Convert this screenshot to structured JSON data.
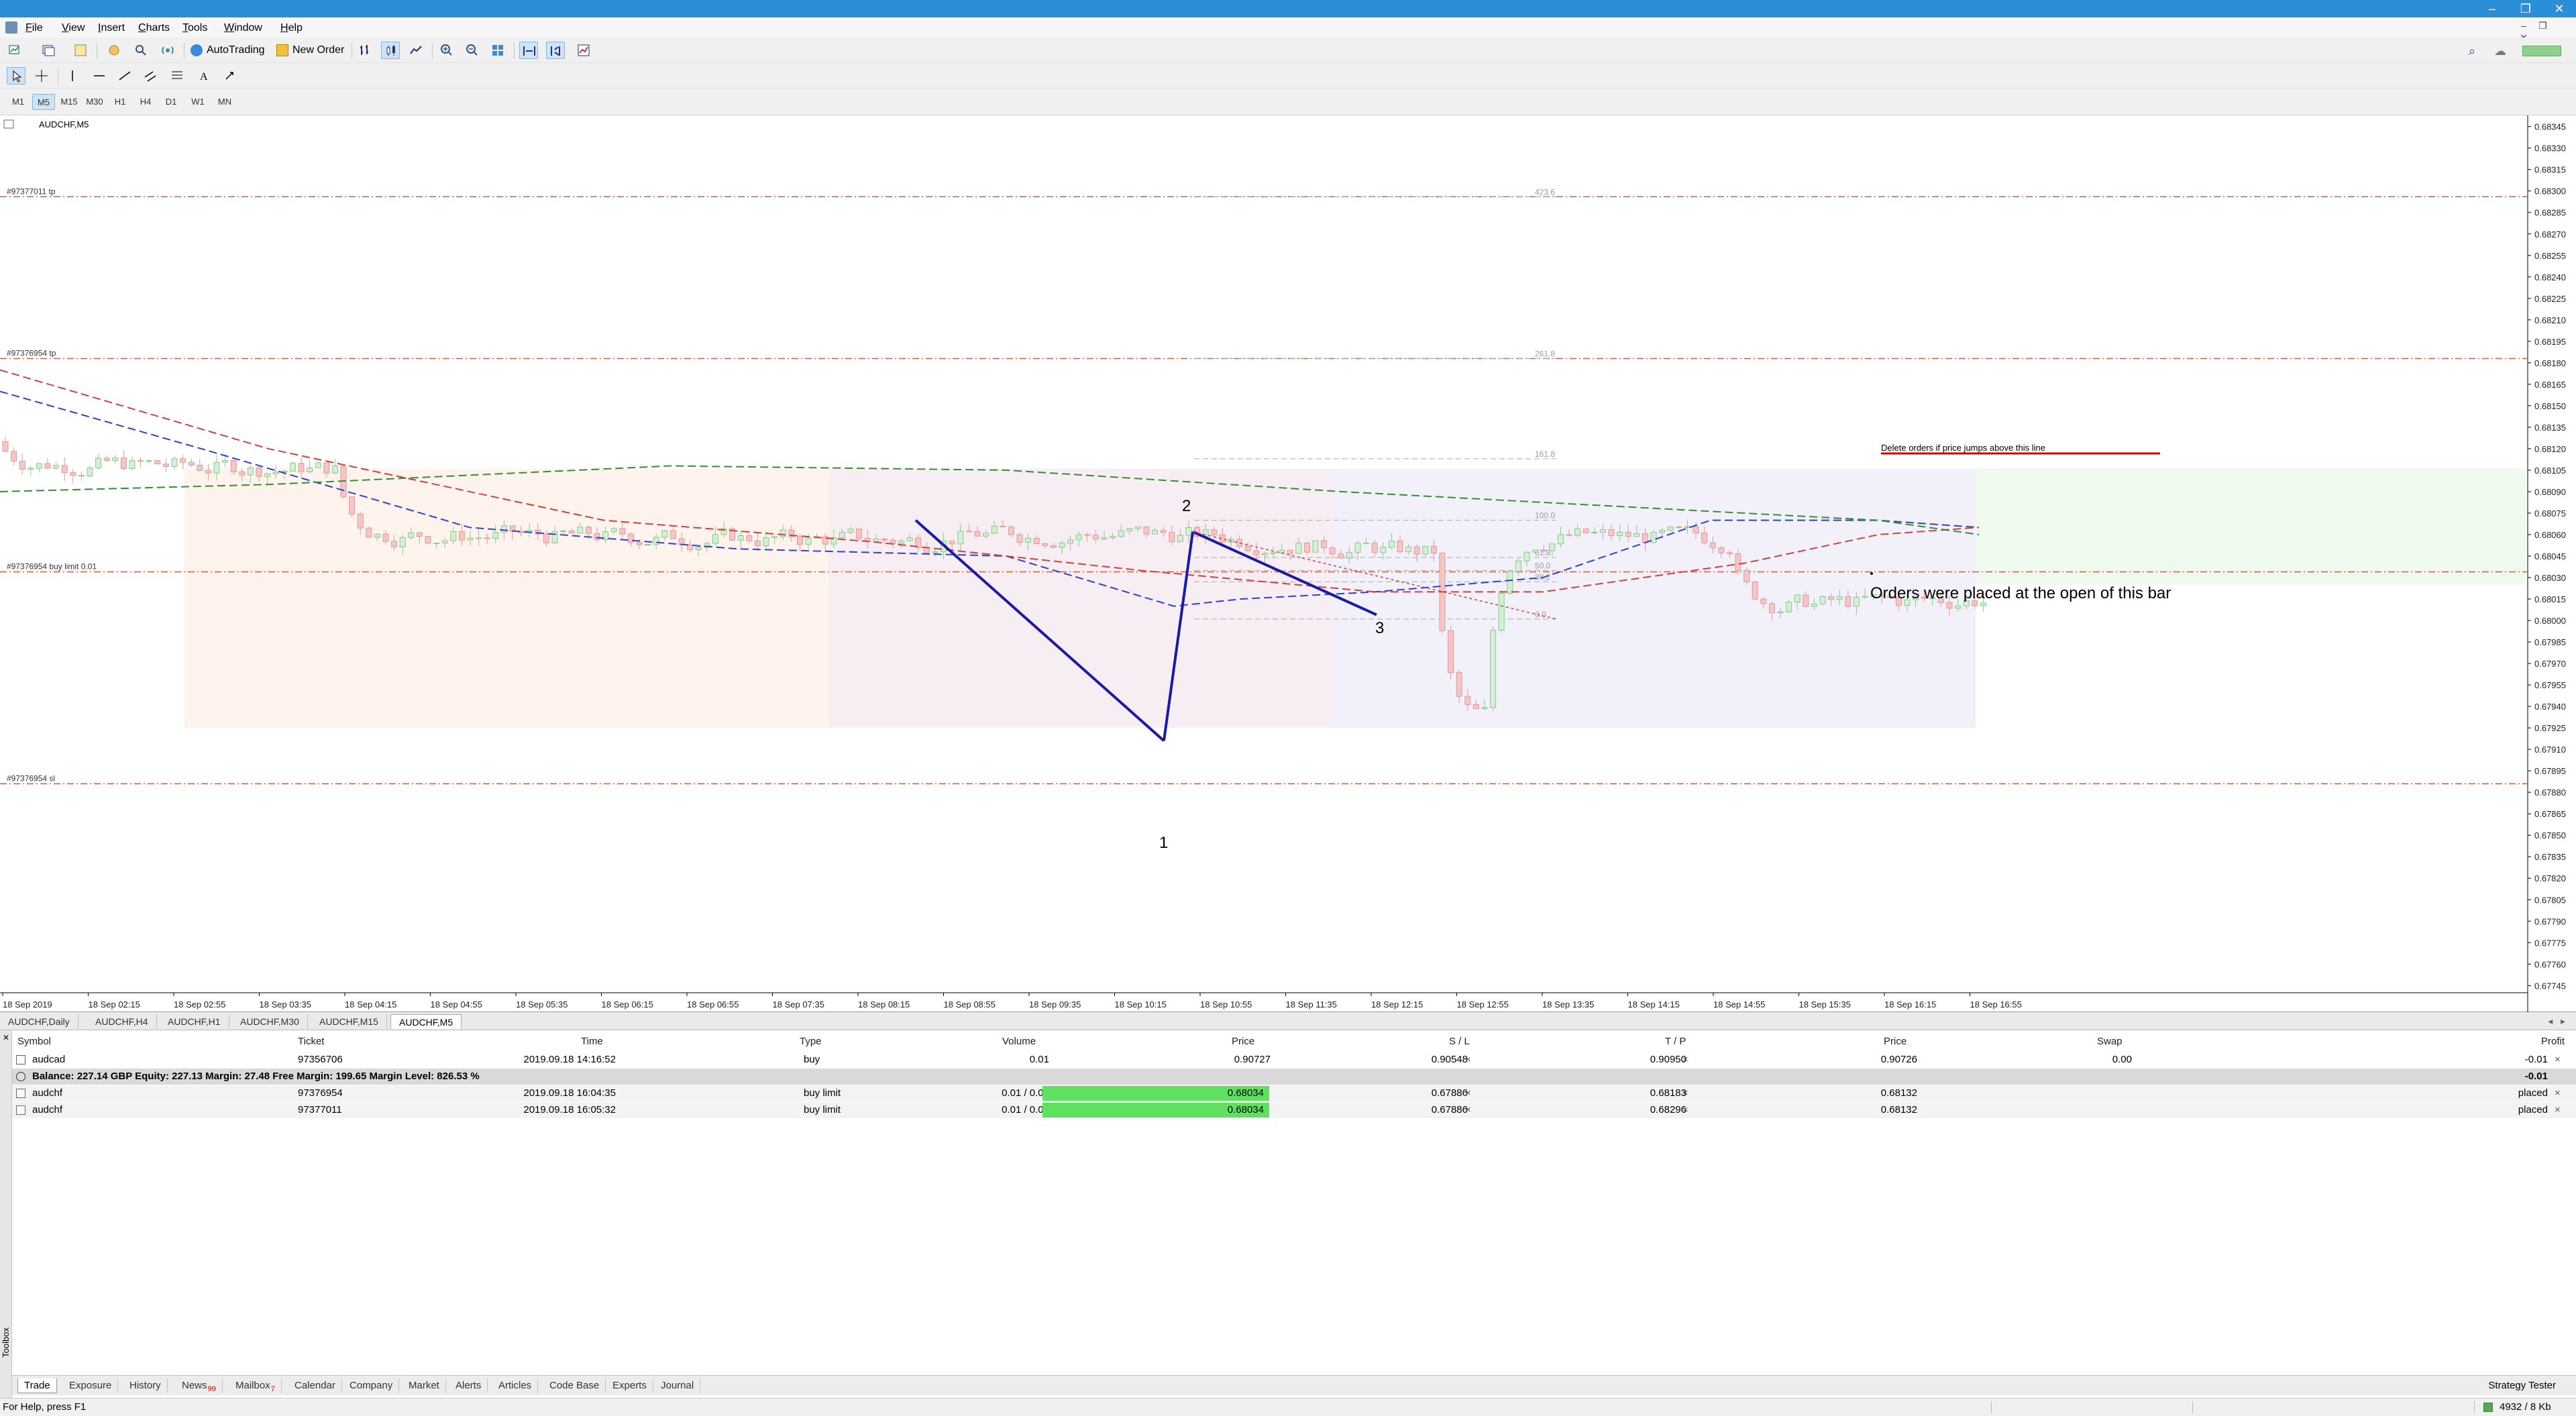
{
  "menu": [
    "File",
    "View",
    "Insert",
    "Charts",
    "Tools",
    "Window",
    "Help"
  ],
  "toolbar": {
    "autotrading": "AutoTrading",
    "new_order": "New Order"
  },
  "timeframes": [
    "M1",
    "M5",
    "M15",
    "M30",
    "H1",
    "H4",
    "D1",
    "W1",
    "MN"
  ],
  "selected_timeframe": "M5",
  "chart": {
    "symbol_label": "AUDCHF,M5",
    "order_lines": [
      {
        "label": "#97377011 tp",
        "price": 0.68296
      },
      {
        "label": "#97376954 tp",
        "price": 0.68183
      },
      {
        "label": "#97376954 buy limit 0.01",
        "price": 0.68034
      },
      {
        "label": "#97376954 sl",
        "price": 0.67886
      }
    ],
    "fib_levels": [
      {
        "label": "423.6",
        "price": 0.68296
      },
      {
        "label": "261.8",
        "price": 0.68183
      },
      {
        "label": "161.8",
        "price": 0.68113
      },
      {
        "label": "100.0",
        "price": 0.6807
      },
      {
        "label": "38.2",
        "price": 0.68027
      },
      {
        "label": "50.0",
        "price": 0.68035
      },
      {
        "label": "61.8",
        "price": 0.68044
      },
      {
        "label": "0.0",
        "price": 0.68001
      }
    ],
    "wave_labels": [
      "1",
      "2",
      "3"
    ],
    "annotation_delete": "Delete orders if price jumps above this line",
    "annotation_orders": "Orders were placed at the open of this bar",
    "price_axis": [
      "0.68345",
      "0.68330",
      "0.68315",
      "0.68300",
      "0.68285",
      "0.68270",
      "0.68255",
      "0.68240",
      "0.68225",
      "0.68210",
      "0.68195",
      "0.68180",
      "0.68165",
      "0.68150",
      "0.68135",
      "0.68120",
      "0.68105",
      "0.68090",
      "0.68075",
      "0.68060",
      "0.68045",
      "0.68030",
      "0.68015",
      "0.68000",
      "0.67985",
      "0.67970",
      "0.67955",
      "0.67940",
      "0.67925",
      "0.67910",
      "0.67895",
      "0.67880",
      "0.67865",
      "0.67850",
      "0.67835",
      "0.67820",
      "0.67805",
      "0.67790",
      "0.67775",
      "0.67760",
      "0.67745"
    ],
    "price_min": 0.6774,
    "price_max": 0.6835,
    "time_axis": [
      "18 Sep 2019",
      "18 Sep 02:15",
      "18 Sep 02:55",
      "18 Sep 03:35",
      "18 Sep 04:15",
      "18 Sep 04:55",
      "18 Sep 05:35",
      "18 Sep 06:15",
      "18 Sep 06:55",
      "18 Sep 07:35",
      "18 Sep 08:15",
      "18 Sep 08:55",
      "18 Sep 09:35",
      "18 Sep 10:15",
      "18 Sep 10:55",
      "18 Sep 11:35",
      "18 Sep 12:15",
      "18 Sep 12:55",
      "18 Sep 13:35",
      "18 Sep 14:15",
      "18 Sep 14:55",
      "18 Sep 15:35",
      "18 Sep 16:15",
      "18 Sep 16:55"
    ],
    "colors": {
      "bull": "#d4f0d4",
      "bear": "#f4c6c6",
      "ma_blue": "#3040d0",
      "ma_red": "#d04040",
      "ma_green": "#309030",
      "wave": "#1a1aa8",
      "order_line": "#d06040"
    }
  },
  "chart_tabs": [
    "AUDCHF,Daily",
    "AUDCHF,H4",
    "AUDCHF,H1",
    "AUDCHF,M30",
    "AUDCHF,M15",
    "AUDCHF,M5"
  ],
  "active_chart_tab": "AUDCHF,M5",
  "terminal": {
    "headers": {
      "symbol": "Symbol",
      "ticket": "Ticket",
      "time": "Time",
      "type": "Type",
      "volume": "Volume",
      "price": "Price",
      "sl": "S / L",
      "tp": "T / P",
      "price2": "Price",
      "swap": "Swap",
      "profit": "Profit"
    },
    "position": {
      "symbol": "audcad",
      "ticket": "97356706",
      "time": "2019.09.18 14:16:52",
      "type": "buy",
      "volume": "0.01",
      "price": "0.90727",
      "sl": "0.90548",
      "tp": "0.90950",
      "price2": "0.90726",
      "swap": "0.00",
      "profit": "-0.01"
    },
    "balance": {
      "text": "Balance: 227.14 GBP  Equity: 227.13  Margin: 27.48  Free Margin: 199.65  Margin Level: 826.53 %",
      "profit": "-0.01"
    },
    "orders": [
      {
        "symbol": "audchf",
        "ticket": "97376954",
        "time": "2019.09.18 16:04:35",
        "type": "buy limit",
        "volume": "0.01 / 0.00",
        "price": "0.68034",
        "sl": "0.67886",
        "tp": "0.68183",
        "price2": "0.68132",
        "profit": "placed"
      },
      {
        "symbol": "audchf",
        "ticket": "97377011",
        "time": "2019.09.18 16:05:32",
        "type": "buy limit",
        "volume": "0.01 / 0.00",
        "price": "0.68034",
        "sl": "0.67886",
        "tp": "0.68296",
        "price2": "0.68132",
        "profit": "placed"
      }
    ],
    "close_glyph": "×",
    "tabs": [
      {
        "label": "Trade"
      },
      {
        "label": "Exposure"
      },
      {
        "label": "History"
      },
      {
        "label": "News",
        "badge": "99"
      },
      {
        "label": "Mailbox",
        "badge": "7"
      },
      {
        "label": "Calendar"
      },
      {
        "label": "Company"
      },
      {
        "label": "Market"
      },
      {
        "label": "Alerts"
      },
      {
        "label": "Articles"
      },
      {
        "label": "Code Base"
      },
      {
        "label": "Experts"
      },
      {
        "label": "Journal"
      }
    ],
    "strategy_tester": "Strategy Tester",
    "side_label": "Toolbox"
  },
  "status": {
    "help": "For Help, press F1",
    "traffic": "4932 / 8 Kb"
  }
}
